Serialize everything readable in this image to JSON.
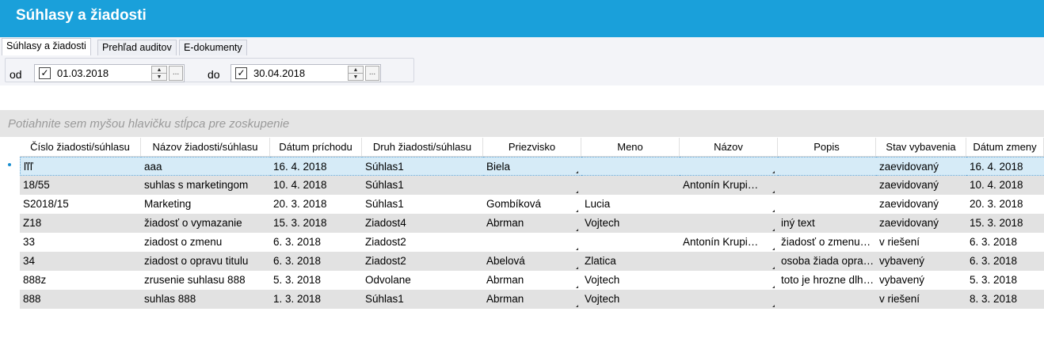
{
  "window": {
    "title": "Súhlasy a žiadosti"
  },
  "tabs": [
    {
      "label": "Súhlasy a žiadosti",
      "active": true
    },
    {
      "label": "Prehľad auditov",
      "active": false
    },
    {
      "label": "E-dokumenty",
      "active": false
    }
  ],
  "filter": {
    "from_label": "od",
    "from_date": "01.03.2018",
    "from_checked": true,
    "to_label": "do",
    "to_date": "30.04.2018",
    "to_checked": true,
    "check_glyph": "✓",
    "ellipsis_label": "...",
    "spin_up": "▲",
    "spin_down": "▼"
  },
  "grid": {
    "group_hint": "Potiahnite sem myšou hlavičku stĺpca pre zoskupenie",
    "columns": [
      "Číslo žiadosti/súhlasu",
      "Názov žiadosti/súhlasu",
      "Dátum príchodu",
      "Druh žiadosti/súhlasu",
      "Priezvisko",
      "Meno",
      "Názov",
      "Popis",
      "Stav vybavenia",
      "Dátum zmeny"
    ],
    "rows": [
      [
        "ľľľ",
        "aaa",
        "16. 4. 2018",
        "Súhlas1",
        "Biela",
        "",
        "",
        "",
        "zaevidovaný",
        "16. 4. 2018"
      ],
      [
        "18/55",
        "suhlas s marketingom",
        "10. 4. 2018",
        "Súhlas1",
        "",
        "",
        "Antonín Krupi…",
        "",
        "zaevidovaný",
        "10. 4. 2018"
      ],
      [
        "S2018/15",
        "Marketing",
        "20. 3. 2018",
        "Súhlas1",
        "Gombíková",
        "Lucia",
        "",
        "",
        "zaevidovaný",
        "20. 3. 2018"
      ],
      [
        "Z18",
        "žiadosť o vymazanie",
        "15. 3. 2018",
        "Ziadost4",
        "Abrman",
        "Vojtech",
        "",
        "iný text",
        "zaevidovaný",
        "15. 3. 2018"
      ],
      [
        "33",
        "ziadost o zmenu",
        "6. 3. 2018",
        "Ziadost2",
        "",
        "",
        "Antonín Krupi…",
        "žiadosť o zmenu…",
        "v riešení",
        "6. 3. 2018"
      ],
      [
        "34",
        "ziadost o opravu titulu",
        "6. 3. 2018",
        "Ziadost2",
        "Abelová",
        "Zlatica",
        "",
        "osoba žiada opra…",
        "vybavený",
        "6. 3. 2018"
      ],
      [
        "888z",
        "zrusenie suhlasu 888",
        "5. 3. 2018",
        "Odvolane",
        "Abrman",
        "Vojtech",
        "",
        "toto je hrozne dlh…",
        "vybavený",
        "5. 3. 2018"
      ],
      [
        "888",
        "suhlas 888",
        "1. 3. 2018",
        "Súhlas1",
        "Abrman",
        "Vojtech",
        "",
        "",
        "v riešení",
        "8. 3. 2018"
      ]
    ]
  }
}
